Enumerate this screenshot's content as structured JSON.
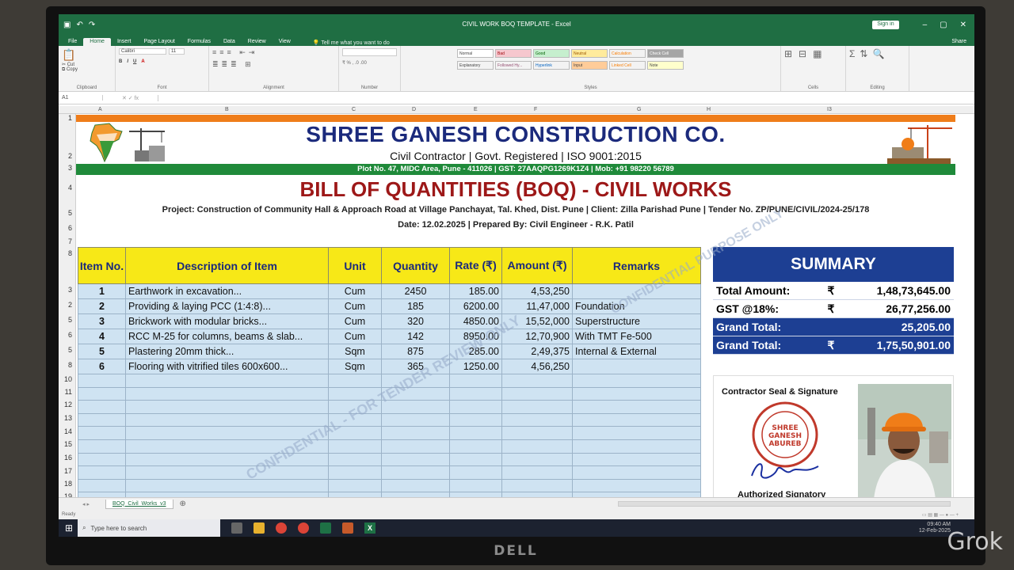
{
  "window": {
    "doc_title": "CIVIL WORK BOQ TEMPLATE - Excel",
    "signin": "Sign in",
    "share": "Share",
    "tabs": [
      "File",
      "Home",
      "Insert",
      "Page Layout",
      "Formulas",
      "Data",
      "Review",
      "View"
    ],
    "tell_me": "Tell me what you want to do",
    "name_box": "A1",
    "ribbon_groups": [
      "Clipboard",
      "Font",
      "Alignment",
      "Number",
      "Styles",
      "Cells",
      "Editing"
    ],
    "style_cells": [
      "Normal",
      "Bad",
      "Good",
      "Neutral",
      "Calculation",
      "Check Cell",
      "Explanatory",
      "Followed Hy...",
      "Hyperlink",
      "Input",
      "Linked Cell",
      "Note"
    ],
    "font_name": "Calibri",
    "font_size": "11"
  },
  "columns": [
    "A",
    "B",
    "C",
    "D",
    "E",
    "F",
    "G",
    "H",
    "I3"
  ],
  "rows": [
    "1",
    "2",
    "3",
    "4",
    "5",
    "6",
    "7",
    "8",
    "3",
    "2",
    "5",
    "6",
    "5",
    "8",
    "10",
    "11",
    "12",
    "13",
    "14",
    "15",
    "16",
    "17",
    "18",
    "19"
  ],
  "header": {
    "company": "SHREE GANESH CONSTRUCTION CO.",
    "subtitle": "Civil Contractor | Govt. Registered | ISO 9001:2015",
    "address": "Plot No. 47, MIDC Area, Pune - 411026 | GST: 27AAQPG1269K1Z4 | Mob: +91 98220 56789",
    "boq_title": "BILL OF QUANTITIES (BOQ) - CIVIL WORKS",
    "project": "Project: Construction of Community Hall & Approach Road at Village Panchayat, Tal. Khed, Dist. Pune | Client: Zilla Parishad Pune | Tender No. ZP/PUNE/CIVIL/2024-25/178",
    "date": "Date: 12.02.2025 | Prepared By: Civil Engineer - R.K. Patil"
  },
  "table": {
    "headers": [
      "Item No.",
      "Description of Item",
      "Unit",
      "Quantity",
      "Rate (₹)",
      "Amount (₹)",
      "Remarks"
    ],
    "rows": [
      [
        "1",
        "Earthwork in excavation...",
        "Cum",
        "2450",
        "185.00",
        "4,53,250",
        ""
      ],
      [
        "2",
        "Providing & laying PCC (1:4:8)...",
        "Cum",
        "185",
        "6200.00",
        "11,47,000",
        "Foundation"
      ],
      [
        "3",
        "Brickwork with modular bricks...",
        "Cum",
        "320",
        "4850.00",
        "15,52,000",
        "Superstructure"
      ],
      [
        "4",
        "RCC M-25 for columns, beams & slab...",
        "Cum",
        "142",
        "8950.00",
        "12,70,900",
        "With TMT Fe-500"
      ],
      [
        "5",
        "Plastering 20mm thick...",
        "Sqm",
        "875",
        "285.00",
        "2,49,375",
        "Internal & External"
      ],
      [
        "6",
        "Flooring with vitrified tiles 600x600...",
        "Sqm",
        "365",
        "1250.00",
        "4,56,250",
        ""
      ]
    ],
    "empty_rows": 10
  },
  "summary": {
    "title": "SUMMARY",
    "rows": [
      {
        "label": "Total Amount:",
        "sym": "₹",
        "value": "1,48,73,645.00",
        "blue": false
      },
      {
        "label": "GST @18%:",
        "sym": "₹",
        "value": "26,77,256.00",
        "blue": false
      },
      {
        "label": "Grand Total:",
        "sym": "",
        "value": "25,205.00",
        "blue": true
      },
      {
        "label": "Grand Total:",
        "sym": "₹",
        "value": "1,75,50,901.00",
        "blue": true
      }
    ],
    "seal_label": "Contractor Seal & Signature",
    "seal_text": [
      "SHREE",
      "GANESH",
      "ABUREB"
    ],
    "auth_label": "Authorized Signatory"
  },
  "watermarks": [
    "CONFIDENTIAL - FOR TENDER REVIEW ONLY",
    "CONFIDENTIAL PURPOSE ONLY"
  ],
  "sheet_tab": "BOQ_Civil_Works_v3",
  "status": "Ready",
  "taskbar": {
    "search": "Type here to search",
    "time": "09:40 AM",
    "date": "12-Feb-2025"
  },
  "brand": {
    "monitor": "DELL",
    "grok": "Grok"
  },
  "colors": {
    "excel_green": "#1f6e43",
    "orange": "#ef7d1a",
    "green_band": "#1f8a3a",
    "navy": "#1b2a7c",
    "boq_red": "#9d1818",
    "yellow": "#f7e817",
    "cell_blue": "#cfe3f2",
    "summary_blue": "#1d3f93"
  }
}
